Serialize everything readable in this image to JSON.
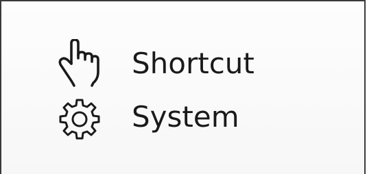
{
  "menu": {
    "items": [
      {
        "label": "Shortcut",
        "icon": "hand-pointer-icon"
      },
      {
        "label": "System",
        "icon": "gear-icon"
      }
    ]
  },
  "colors": {
    "text": "#1a1a1a",
    "border": "#3a3a3a",
    "background": "#f9f9f9"
  }
}
